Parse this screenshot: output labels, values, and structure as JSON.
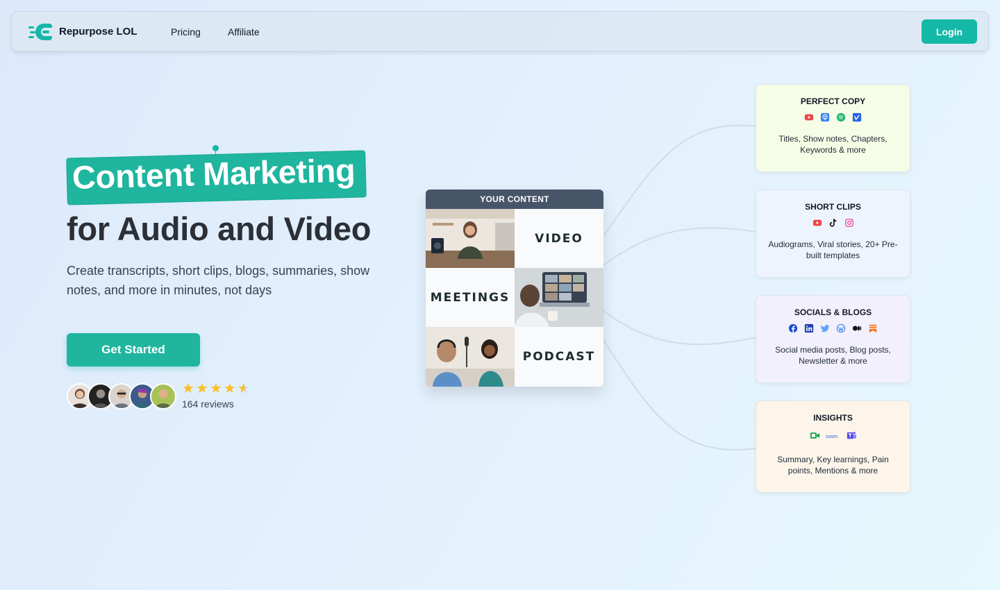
{
  "nav": {
    "brand": "Repurpose LOL",
    "links": [
      "Pricing",
      "Affiliate"
    ],
    "login_label": "Login"
  },
  "hero": {
    "headline_highlight": "Content Marketing",
    "headline_rest": "for Audio and Video",
    "subtitle": "Create transcripts, short clips, blogs, summaries, show notes, and more in minutes, not days",
    "cta_label": "Get Started",
    "rating_stars": 4.5,
    "reviews_text": "164 reviews"
  },
  "content": {
    "header": "YOUR CONTENT",
    "labels": [
      "VIDEO",
      "MEETINGS",
      "PODCAST"
    ]
  },
  "features": [
    {
      "title": "PERFECT COPY",
      "icons": [
        "youtube-icon",
        "apple-podcasts-icon",
        "spotify-icon",
        "vimeo-icon"
      ],
      "description": "Titles, Show notes, Chapters, Keywords & more",
      "bg": "#f6fde6"
    },
    {
      "title": "SHORT CLIPS",
      "icons": [
        "youtube-icon",
        "tiktok-icon",
        "instagram-icon"
      ],
      "description": "Audiograms, Viral stories, 20+ Pre-built templates",
      "bg": "#eef4fe"
    },
    {
      "title": "SOCIALS & BLOGS",
      "icons": [
        "facebook-icon",
        "linkedin-icon",
        "twitter-icon",
        "wordpress-icon",
        "medium-icon",
        "substack-icon"
      ],
      "description": "Social media posts, Blog posts, Newsletter & more",
      "bg": "#f3f0fd"
    },
    {
      "title": "INSIGHTS",
      "icons": [
        "google-meet-icon",
        "zoom-icon",
        "teams-icon"
      ],
      "description": "Summary, Key learnings, Pain points, Mentions & more",
      "bg": "#fdf5ea"
    }
  ],
  "colors": {
    "accent": "#14b8a6",
    "highlight": "#1fb59e",
    "star": "#fbbf24",
    "content_header": "#475569"
  }
}
